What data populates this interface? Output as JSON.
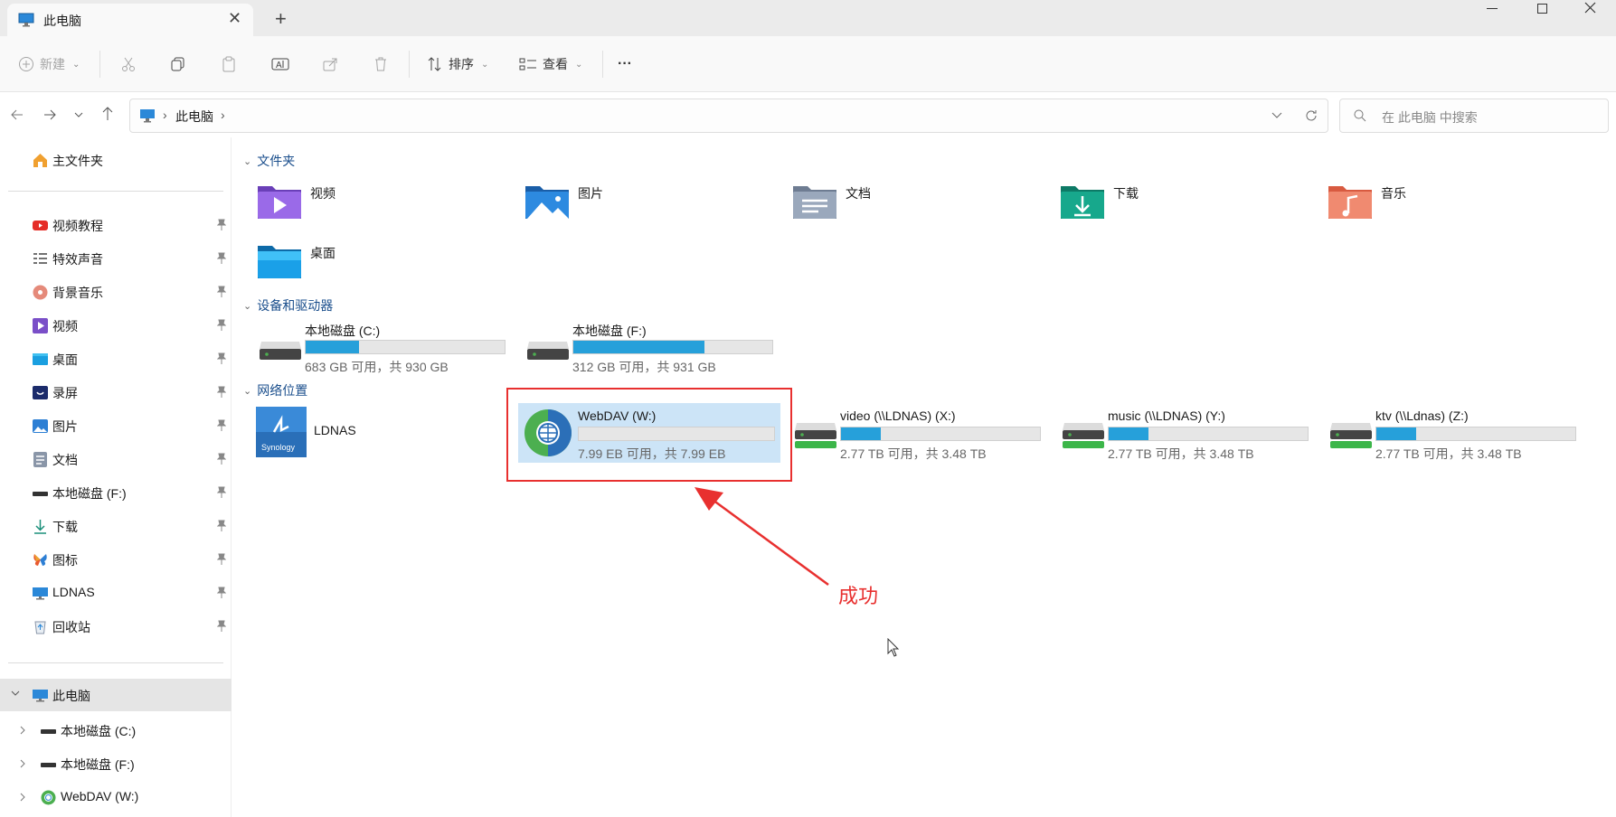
{
  "window": {
    "tab_title": "此电脑",
    "close_tab": "✕",
    "new_tab": "+"
  },
  "toolbar": {
    "new_label": "新建",
    "sort_label": "排序",
    "view_label": "查看",
    "more_label": "···"
  },
  "address": {
    "path": "此电脑",
    "sep": "›",
    "search_placeholder": "在 此电脑 中搜索"
  },
  "sidebar": {
    "home": "主文件夹",
    "pinned": [
      {
        "label": "视频教程",
        "icon": "youtube-icon"
      },
      {
        "label": "特效声音",
        "icon": "list-icon"
      },
      {
        "label": "背景音乐",
        "icon": "music-disc-icon"
      },
      {
        "label": "视频",
        "icon": "video-folder-icon"
      },
      {
        "label": "桌面",
        "icon": "desktop-folder-icon"
      },
      {
        "label": "录屏",
        "icon": "record-icon"
      },
      {
        "label": "图片",
        "icon": "pictures-folder-icon"
      },
      {
        "label": "文档",
        "icon": "documents-icon"
      },
      {
        "label": "本地磁盘 (F:)",
        "icon": "drive-icon"
      },
      {
        "label": "下载",
        "icon": "download-icon"
      },
      {
        "label": "图标",
        "icon": "butterfly-icon"
      },
      {
        "label": "LDNAS",
        "icon": "monitor-icon"
      },
      {
        "label": "回收站",
        "icon": "recycle-bin-icon"
      }
    ],
    "this_pc": "此电脑",
    "children": [
      {
        "label": "本地磁盘 (C:)"
      },
      {
        "label": "本地磁盘 (F:)"
      },
      {
        "label": "WebDAV (W:)"
      }
    ]
  },
  "content": {
    "folders_header": "文件夹",
    "folders": [
      {
        "label": "视频"
      },
      {
        "label": "图片"
      },
      {
        "label": "文档"
      },
      {
        "label": "下载"
      },
      {
        "label": "音乐"
      },
      {
        "label": "桌面"
      }
    ],
    "drives_header": "设备和驱动器",
    "drives": [
      {
        "name": "本地磁盘 (C:)",
        "sub": "683 GB 可用，共 930 GB",
        "used_fraction": 0.27
      },
      {
        "name": "本地磁盘 (F:)",
        "sub": "312 GB 可用，共 931 GB",
        "used_fraction": 0.66
      }
    ],
    "network_header": "网络位置",
    "network": [
      {
        "name": "LDNAS",
        "brand": "Synology"
      },
      {
        "name": "WebDAV (W:)",
        "sub": "7.99 EB 可用，共 7.99 EB",
        "used_fraction": 0.0
      },
      {
        "name": "video (\\\\LDNAS) (X:)",
        "sub": "2.77 TB 可用，共 3.48 TB",
        "used_fraction": 0.2
      },
      {
        "name": "music (\\\\LDNAS) (Y:)",
        "sub": "2.77 TB 可用，共 3.48 TB",
        "used_fraction": 0.2
      },
      {
        "name": "ktv (\\\\Ldnas) (Z:)",
        "sub": "2.77 TB 可用，共 3.48 TB",
        "used_fraction": 0.2
      }
    ]
  },
  "annotation": {
    "text": "成功",
    "color": "#e8302f"
  },
  "colors": {
    "accent": "#26a0da",
    "selected": "#cce4f7"
  }
}
